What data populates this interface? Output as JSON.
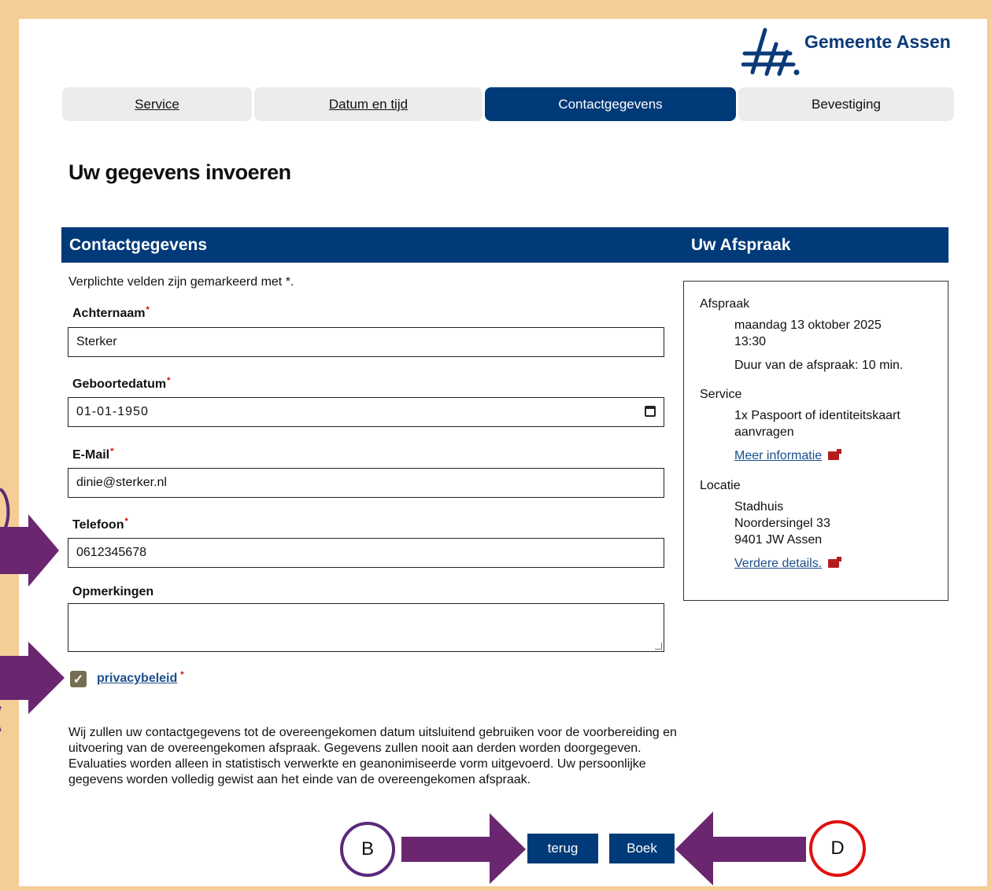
{
  "brand": {
    "name": "Gemeente Assen",
    "color": "#003a78"
  },
  "tabs": [
    {
      "label": "Service",
      "state": "link"
    },
    {
      "label": "Datum en tijd",
      "state": "link"
    },
    {
      "label": "Contactgegevens",
      "state": "active"
    },
    {
      "label": "Bevestiging",
      "state": "inactive"
    }
  ],
  "page_title": "Uw gegevens invoeren",
  "section": {
    "left_title": "Contactgegevens",
    "right_title": "Uw Afspraak"
  },
  "form": {
    "required_note": "Verplichte velden zijn gemarkeerd met *.",
    "required_mark": "*",
    "lastname": {
      "label": "Achternaam",
      "value": "Sterker"
    },
    "birthdate": {
      "label": "Geboortedatum",
      "value": "01-01-1950"
    },
    "email": {
      "label": "E-Mail",
      "value": "dinie@sterker.nl"
    },
    "phone": {
      "label": "Telefoon",
      "value": "0612345678"
    },
    "remarks": {
      "label": "Opmerkingen",
      "value": ""
    },
    "privacy": {
      "label": "privacybeleid",
      "checked": true,
      "check_glyph": "✓"
    },
    "disclaimer": "Wij zullen uw contactgegevens tot de overeengekomen datum uitsluitend gebruiken voor de voorbereiding en uitvoering van de overeengekomen afspraak. Gegevens zullen nooit aan derden worden doorgegeven. Evaluaties worden alleen in statistisch verwerkte en geanonimiseerde vorm uitgevoerd. Uw persoonlijke gegevens worden volledig gewist aan het einde van de overeengekomen afspraak.",
    "back_button": "terug",
    "book_button": "Boek"
  },
  "appointment": {
    "afspraak_label": "Afspraak",
    "date": "maandag 13 oktober 2025",
    "time": "13:30",
    "duration": "Duur van de afspraak: 10 min.",
    "service_label": "Service",
    "service_line1": "1x Paspoort of identiteitskaart",
    "service_line2": "aanvragen",
    "more_info": "Meer informatie",
    "location_label": "Locatie",
    "loc_name": "Stadhuis",
    "loc_street": "Noordersingel 33",
    "loc_city": "9401 JW Assen",
    "details": "Verdere details."
  },
  "annotations": {
    "badge_b": "B",
    "badge_d": "D",
    "arrow_color": "#6b2670",
    "badge_b_color": "#5a2a7a",
    "badge_d_color": "#e01010"
  }
}
